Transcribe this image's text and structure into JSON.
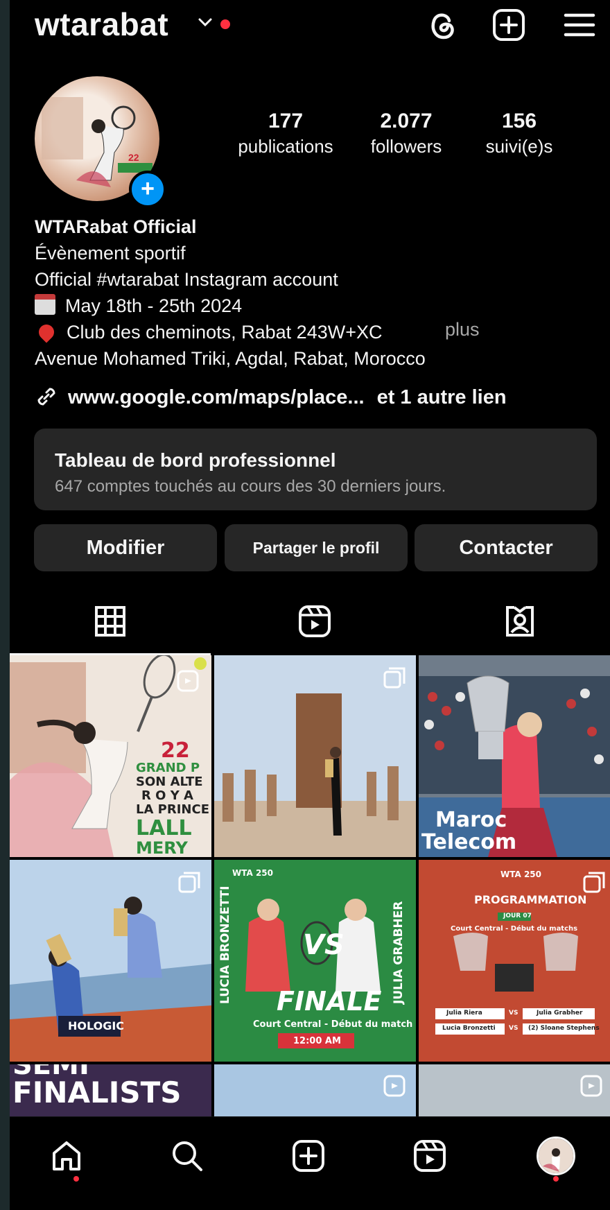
{
  "header": {
    "username": "wtarabat",
    "threads_icon": "threads-icon",
    "create_icon": "plus-square-icon",
    "menu_icon": "hamburger-menu-icon"
  },
  "profile": {
    "stats": [
      {
        "number": "177",
        "label": "publications"
      },
      {
        "number": "2.077",
        "label": "followers"
      },
      {
        "number": "156",
        "label": "suivi(e)s"
      }
    ],
    "name": "WTARabat Official",
    "category": "Évènement sportif",
    "bio_line1": "Official #wtarabat Instagram account",
    "bio_line2": "May 18th - 25th 2024",
    "bio_line3": "Club des cheminots, Rabat 243W+XC",
    "bio_line4": "Avenue Mohamed Triki, Agdal, Rabat, Morocco",
    "more_label": "plus",
    "link_text": "www.google.com/maps/place...",
    "link_extra": "et 1 autre lien"
  },
  "dashboard": {
    "title": "Tableau de bord professionnel",
    "subtitle": "647 comptes touchés au cours des 30 derniers jours."
  },
  "buttons": {
    "edit": "Modifier",
    "share": "Partager le profil",
    "contact": "Contacter"
  },
  "tabs": [
    "grid-icon",
    "reels-icon",
    "tagged-icon"
  ],
  "posts": {
    "p1": {
      "line1": "22",
      "line2": "GRAND P",
      "line3": "SON ALTE",
      "line4": "R O Y A",
      "line5": "LA PRINCE",
      "line6": "LALL",
      "line7": "MERY"
    },
    "p3": {
      "sponsor": "Maroc",
      "sponsor2": "Telecom"
    },
    "p4": {
      "sponsor": "HOLOGIC"
    },
    "p5": {
      "left_name": "LUCIA BRONZETTI",
      "right_name": "JULIA GRABHER",
      "vs": "VS",
      "title": "FINALE",
      "subtitle": "Court Central - Début du match",
      "time": "12:00 AM",
      "brand": "WTA 250"
    },
    "p6": {
      "brand": "WTA 250",
      "title": "PROGRAMMATION",
      "day": "JOUR 07",
      "subtitle": "Court Central - Début du matchs",
      "p1a": "Julia Riera",
      "p1b": "Julia Grabher",
      "p2a": "Lucia Bronzetti",
      "p2b": "(2) Sloane Stephens",
      "vs": "VS"
    },
    "p7": {
      "line1": "SEMI",
      "line2": "FINALISTS"
    }
  },
  "nav": [
    "home-icon",
    "search-icon",
    "create-icon",
    "reels-icon",
    "profile-avatar"
  ],
  "colors": {
    "accent": "#0095f6",
    "notification": "#ff3040",
    "card": "#262626"
  }
}
